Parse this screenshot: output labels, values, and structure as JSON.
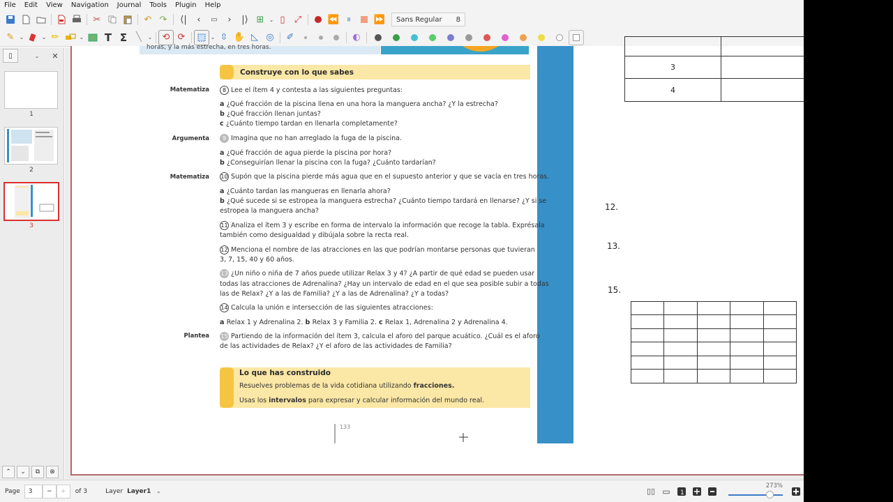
{
  "menu": [
    "File",
    "Edit",
    "View",
    "Navigation",
    "Journal",
    "Tools",
    "Plugin",
    "Help"
  ],
  "toolbar": {
    "font_name": "Sans Regular",
    "font_size": "8"
  },
  "colors": {
    "accent": "#d83030",
    "page_border": "#b5676b",
    "yellow": "#fbe7a6",
    "yellow_dark": "#f5c542",
    "blue": "#3790c8",
    "pen_palette": [
      "#555555",
      "#3a9d4a",
      "#46c0d6",
      "#5ccb6e",
      "#7a7fd0",
      "#999999",
      "#e05555",
      "#e060d0",
      "#f0a050",
      "#eedd44",
      "#ffffff"
    ]
  },
  "sidebar": {
    "pages": [
      {
        "n": "1"
      },
      {
        "n": "2"
      },
      {
        "n": "3"
      }
    ]
  },
  "doc": {
    "section1": "Construye con lo que sabes",
    "top_cut": "horas, y la más estrecha, en tres horas.",
    "labels": {
      "l1": "Matematiza",
      "l2": "Argumenta",
      "l3": "Matematiza",
      "l4": "Plantea"
    },
    "q8": {
      "n": "8",
      "text": "Lee el ítem 4 y contesta a las siguientes preguntas:",
      "a": "¿Qué fracción de la piscina llena en una hora la manguera ancha? ¿Y la estrecha?",
      "b": "¿Qué fracción llenan juntas?",
      "c": "¿Cuánto tiempo tardan en llenarla completamente?"
    },
    "q9": {
      "n": "9",
      "text": "Imagina que no han arreglado la fuga de la piscina.",
      "a": "¿Qué fracción de agua pierde la piscina por hora?",
      "b": "¿Conseguirían llenar la piscina con la fuga? ¿Cuánto tardarían?"
    },
    "q10": {
      "n": "10",
      "text": "Supón que la piscina pierde más agua que en el supuesto anterior y que se vacía en tres horas.",
      "a": "¿Cuánto tardan las mangueras en llenarla ahora?",
      "b1": "¿Qué sucede si se estropea la manguera estrecha? ¿Cuánto tiempo tardará en llenarse? ¿Y si se",
      "b2": "estropea la manguera ancha?"
    },
    "q11": {
      "n": "11",
      "l1": "Analiza el ítem 3 y escribe en forma de intervalo la información que recoge la tabla. Exprésala",
      "l2": "también como desigualdad y dibújala sobre la recta real."
    },
    "q12": {
      "n": "12",
      "l1": "Menciona el nombre de las atracciones en las que podrían montarse personas que tuvieran",
      "l2": "3, 7, 15, 40 y 60 años."
    },
    "q13": {
      "n": "13",
      "l1": "¿Un niño o niña de 7 años puede utilizar Relax 3 y 4? ¿A partir de qué edad se pueden usar",
      "l2": "todas las atracciones de Adrenalina? ¿Hay un intervalo de edad en el que sea posible subir a todas",
      "l3": "las de Relax? ¿Y a las de Familia? ¿Y a las de Adrenalina? ¿Y a todas?"
    },
    "q14": {
      "n": "14",
      "text": "Calcula la unión e intersección de las siguientes atracciones:",
      "a": "Relax 1 y Adrenalina 2.",
      "b": "Relax 3 y Familia 2.",
      "c": "Relax 1, Adrenalina 2 y Adrenalina 4."
    },
    "q15": {
      "n": "15",
      "l1": "Partiendo de la información del ítem 3, calcula el aforo del parque acuático. ¿Cuál es el aforo",
      "l2": "de las actividades de Relax? ¿Y el aforo de las actividades de Familia?"
    },
    "section2": "Lo que has construido",
    "s2_l1a": "Resuelves problemas de la vida cotidiana utilizando ",
    "s2_l1b": "fracciones.",
    "s2_l2a": "Usas los ",
    "s2_l2b": "intervalos",
    "s2_l2c": " para expresar y calcular información del mundo real.",
    "page_number": "133"
  },
  "annot": {
    "t1": [
      "3",
      "4"
    ],
    "n12": "12.",
    "n13": "13.",
    "n15": "15."
  },
  "status": {
    "page_label": "Page",
    "page_value": "3",
    "of": "of 3",
    "layer_label": "Layer",
    "layer_value": "Layer1",
    "zoom": "273%"
  }
}
